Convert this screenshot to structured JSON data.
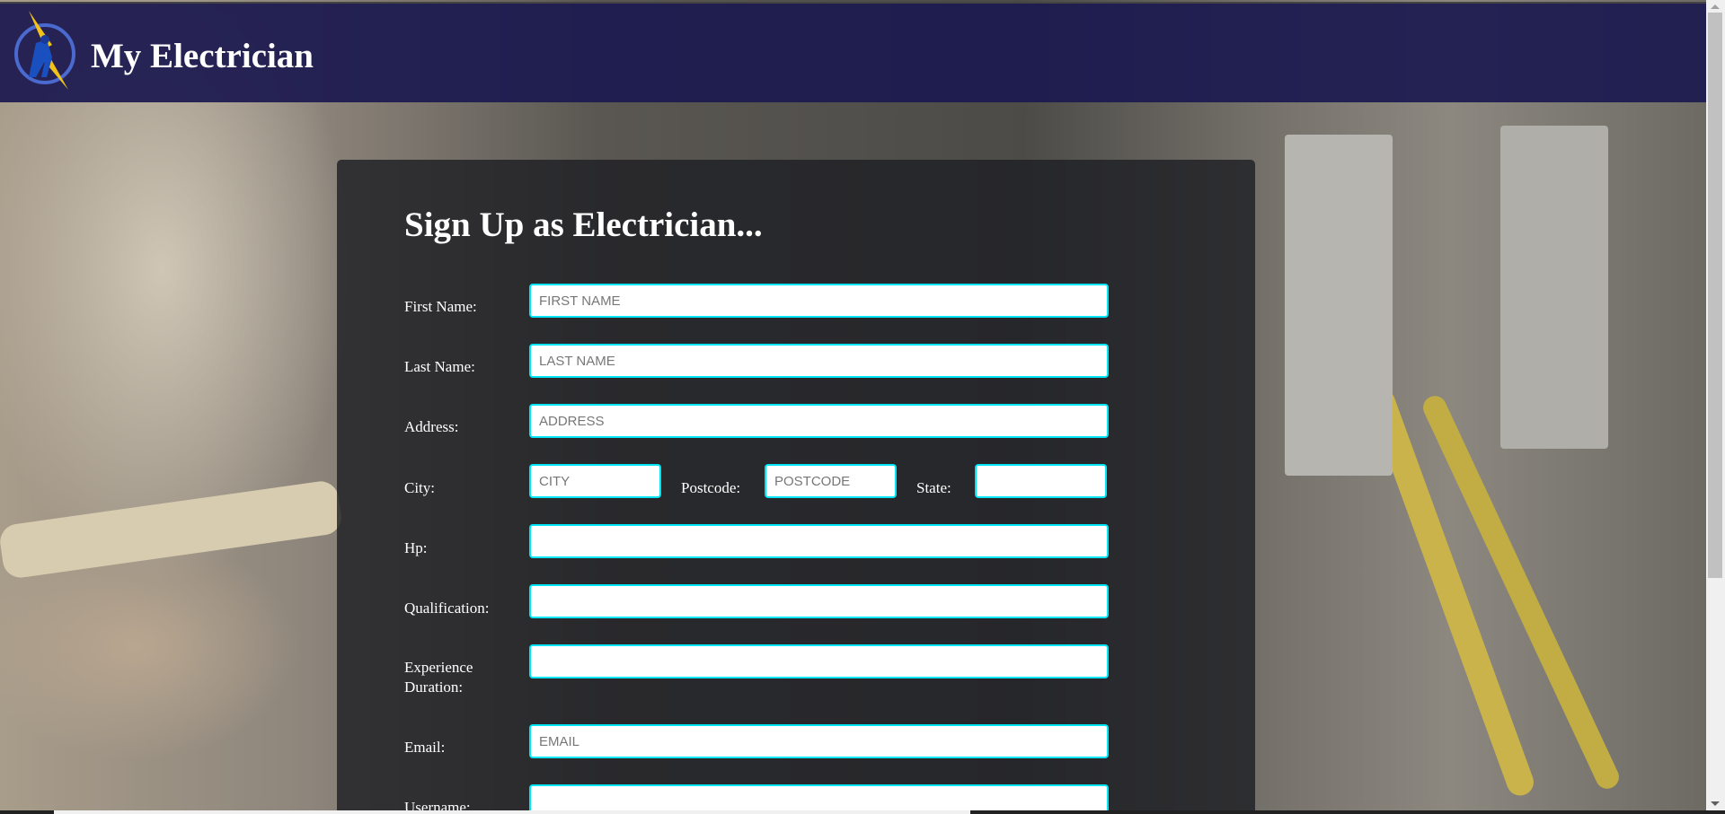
{
  "header": {
    "title": "My Electrician",
    "logo_icon": "electrician-lightning-logo"
  },
  "form": {
    "heading": "Sign Up as Electrician...",
    "fields": [
      {
        "label": "First Name:",
        "placeholder": "FIRST NAME",
        "value": ""
      },
      {
        "label": "Last Name:",
        "placeholder": "LAST NAME",
        "value": ""
      },
      {
        "label": "Address:",
        "placeholder": "ADDRESS",
        "value": ""
      },
      {
        "label": "City:",
        "placeholder": "CITY",
        "value": ""
      },
      {
        "label": "Postcode:",
        "placeholder": "POSTCODE",
        "value": ""
      },
      {
        "label": "State:",
        "placeholder": "",
        "value": ""
      },
      {
        "label": "Hp:",
        "placeholder": "",
        "value": ""
      },
      {
        "label": "Qualification:",
        "placeholder": "",
        "value": ""
      },
      {
        "label": "Experience Duration:",
        "placeholder": "",
        "value": ""
      },
      {
        "label": "Email:",
        "placeholder": "EMAIL",
        "value": ""
      },
      {
        "label": "Username:",
        "placeholder": "",
        "value": ""
      }
    ]
  },
  "colors": {
    "header": "#1c1a50",
    "input_border": "#00e5f5",
    "card": "#1e2024"
  }
}
